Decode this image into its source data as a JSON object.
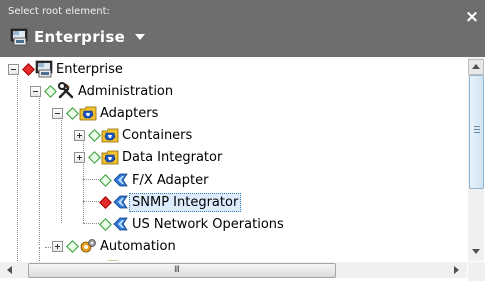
{
  "header": {
    "caption": "Select root element:",
    "root_label": "Enterprise",
    "close_symbol": "×"
  },
  "tree": {
    "nodes": [
      {
        "label": "Enterprise",
        "icon": "enterprise-icon",
        "status": "red",
        "expander": "minus"
      },
      {
        "label": "Administration",
        "icon": "tools-icon",
        "status": "green",
        "expander": "minus"
      },
      {
        "label": "Adapters",
        "icon": "adapters-folder-icon",
        "status": "green",
        "expander": "minus"
      },
      {
        "label": "Containers",
        "icon": "adapters-folder-icon",
        "status": "green",
        "expander": "plus"
      },
      {
        "label": "Data Integrator",
        "icon": "adapters-folder-icon",
        "status": "green",
        "expander": "plus"
      },
      {
        "label": "F/X Adapter",
        "icon": "adapter-icon",
        "status": "green",
        "expander": "none"
      },
      {
        "label": "SNMP Integrator",
        "icon": "adapter-icon",
        "status": "red",
        "expander": "none",
        "selected": true
      },
      {
        "label": "US Network Operations",
        "icon": "adapter-icon",
        "status": "green",
        "expander": "none"
      },
      {
        "label": "Automation",
        "icon": "automation-icon",
        "status": "green",
        "expander": "plus"
      }
    ]
  },
  "scrollbars": {
    "horizontal_grip": "III"
  },
  "colors": {
    "header_bg": "#6e6e6e",
    "status_red": "#e52b2b",
    "status_green": "#2e9a2e",
    "selection_bg": "#dcecfc"
  }
}
